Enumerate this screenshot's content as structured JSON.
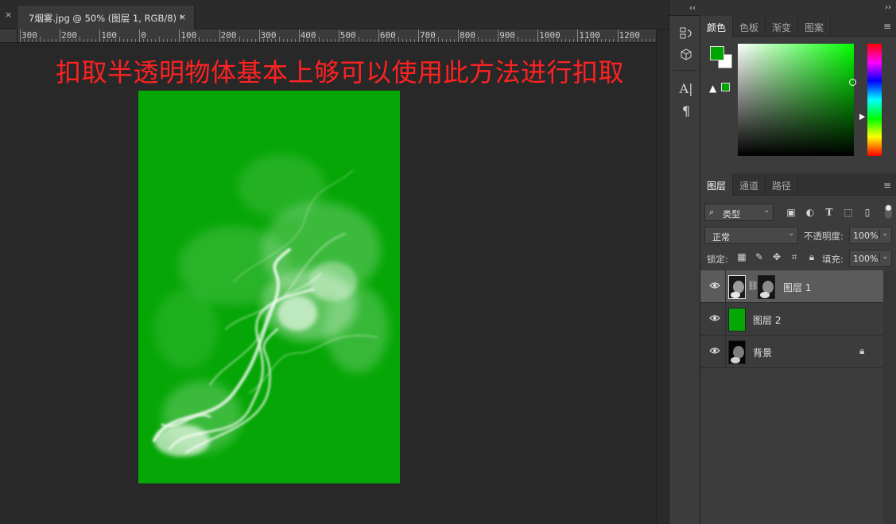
{
  "document": {
    "tab_title": "7烟雾.jpg @ 50% (图层 1, RGB/8) *",
    "close_glyph": "×",
    "heading": "扣取半透明物体基本上够可以使用此方法进行扣取"
  },
  "ruler": {
    "labels": [
      "300",
      "200",
      "100",
      "0",
      "100",
      "200",
      "300",
      "400",
      "500",
      "600",
      "700",
      "800",
      "900",
      "1000",
      "1100",
      "1200"
    ]
  },
  "colors": {
    "fill_green": "#05a605",
    "foreground": "#00a300",
    "background": "#ffffff",
    "heading_red": "#ff2222"
  },
  "icon_strip": {
    "collapse": "‹‹",
    "icons": [
      "history-icon",
      "3d-icon",
      "character-icon",
      "paragraph-icon"
    ]
  },
  "color_panel": {
    "collapse": "››",
    "tabs": [
      "颜色",
      "色板",
      "渐变",
      "图案"
    ],
    "active_tab": "颜色"
  },
  "layers_panel": {
    "tabs": [
      "图层",
      "通道",
      "路径"
    ],
    "active_tab": "图层",
    "filter_kind": "类型",
    "blend_mode": "正常",
    "opacity_label": "不透明度:",
    "opacity": "100%",
    "lock_label": "锁定:",
    "fill_label": "填充:",
    "fill": "100%",
    "layers": [
      {
        "name": "图层 1",
        "selected": true,
        "has_mask": true
      },
      {
        "name": "图层 2",
        "selected": false,
        "has_mask": false
      },
      {
        "name": "背景",
        "selected": false,
        "locked": true
      }
    ]
  }
}
